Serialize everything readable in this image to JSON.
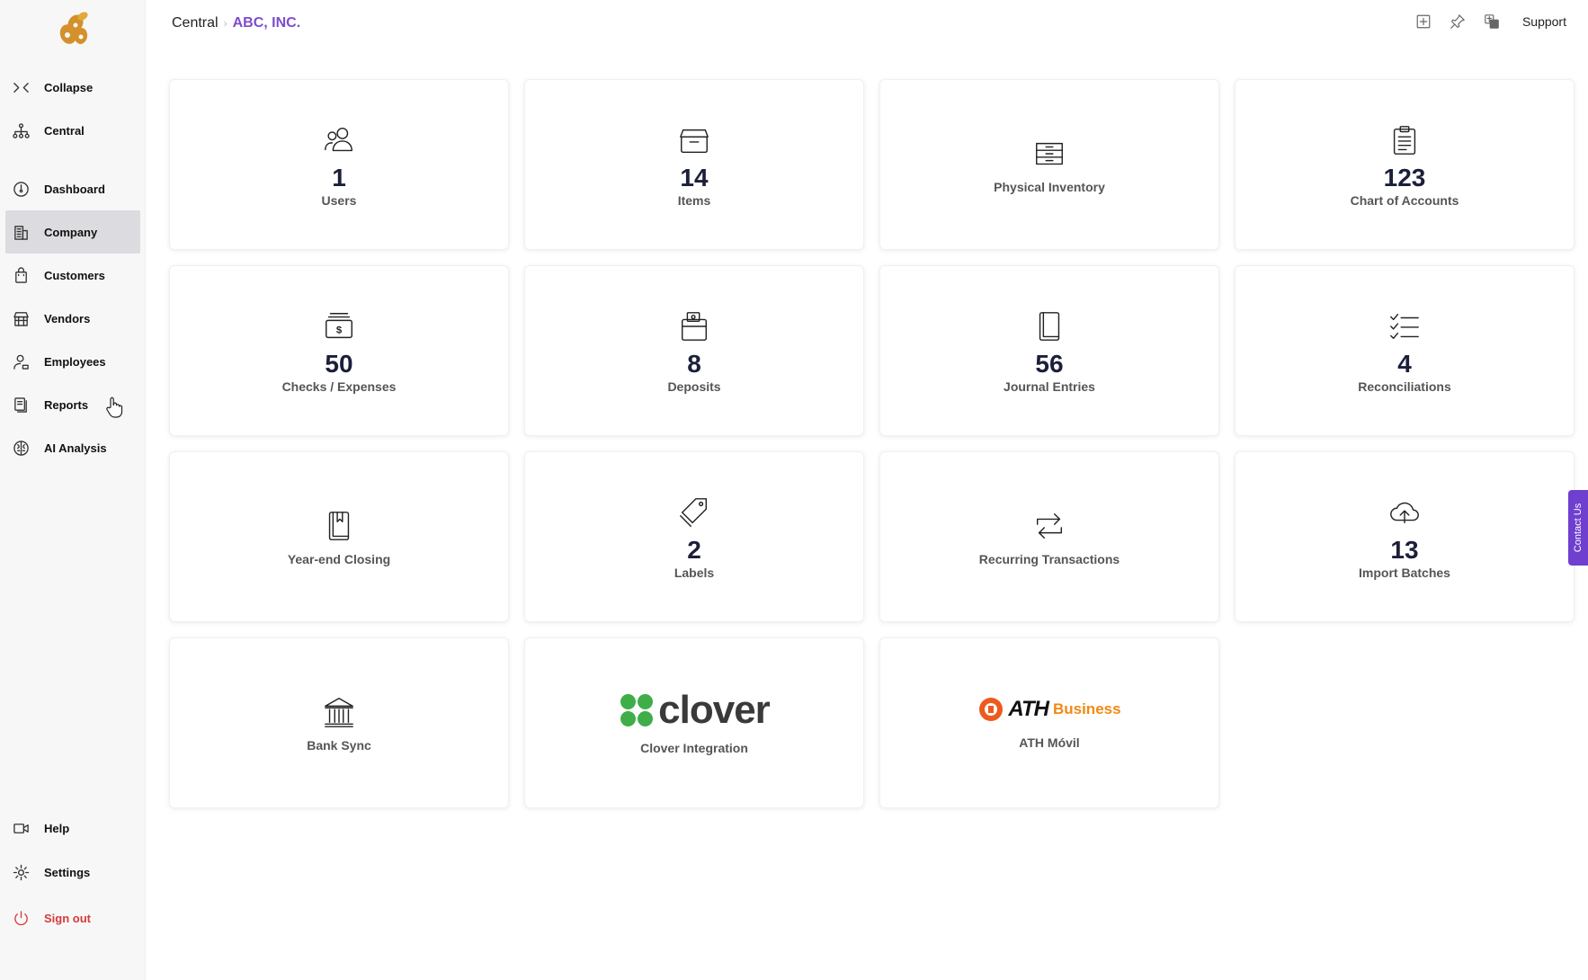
{
  "breadcrumb": {
    "root": "Central",
    "separator": "›",
    "company": "ABC, INC."
  },
  "topbar": {
    "support_label": "Support"
  },
  "sidebar": {
    "items": [
      {
        "id": "collapse",
        "label": "Collapse",
        "icon": "collapse-icon"
      },
      {
        "id": "central",
        "label": "Central",
        "icon": "sitemap-icon"
      },
      {
        "id": "dashboard",
        "label": "Dashboard",
        "icon": "gauge-icon"
      },
      {
        "id": "company",
        "label": "Company",
        "icon": "building-icon",
        "active": true
      },
      {
        "id": "customers",
        "label": "Customers",
        "icon": "shopping-bag-icon"
      },
      {
        "id": "vendors",
        "label": "Vendors",
        "icon": "store-icon"
      },
      {
        "id": "employees",
        "label": "Employees",
        "icon": "employee-icon"
      },
      {
        "id": "reports",
        "label": "Reports",
        "icon": "report-icon"
      },
      {
        "id": "ai-analysis",
        "label": "AI Analysis",
        "icon": "brain-icon"
      },
      {
        "id": "help",
        "label": "Help",
        "icon": "video-icon"
      },
      {
        "id": "settings",
        "label": "Settings",
        "icon": "gear-icon"
      },
      {
        "id": "signout",
        "label": "Sign out",
        "icon": "power-icon"
      }
    ]
  },
  "cards": [
    {
      "id": "users",
      "count": "1",
      "label": "Users",
      "icon": "users-icon"
    },
    {
      "id": "items",
      "count": "14",
      "label": "Items",
      "icon": "archive-box-icon"
    },
    {
      "id": "physical-inventory",
      "label": "Physical Inventory",
      "icon": "drawers-icon"
    },
    {
      "id": "chart-of-accounts",
      "count": "123",
      "label": "Chart of Accounts",
      "icon": "clipboard-icon"
    },
    {
      "id": "checks-expenses",
      "count": "50",
      "label": "Checks / Expenses",
      "icon": "cash-icon"
    },
    {
      "id": "deposits",
      "count": "8",
      "label": "Deposits",
      "icon": "wallet-icon"
    },
    {
      "id": "journal-entries",
      "count": "56",
      "label": "Journal Entries",
      "icon": "journal-icon"
    },
    {
      "id": "reconciliations",
      "count": "4",
      "label": "Reconciliations",
      "icon": "checklist-icon"
    },
    {
      "id": "year-end-closing",
      "label": "Year-end Closing",
      "icon": "bookmark-book-icon"
    },
    {
      "id": "labels",
      "count": "2",
      "label": "Labels",
      "icon": "tags-icon"
    },
    {
      "id": "recurring-transactions",
      "label": "Recurring Transactions",
      "icon": "repeat-icon"
    },
    {
      "id": "import-batches",
      "count": "13",
      "label": "Import Batches",
      "icon": "cloud-upload-icon"
    },
    {
      "id": "bank-sync",
      "label": "Bank Sync",
      "icon": "bank-icon"
    },
    {
      "id": "clover-integration",
      "label": "Clover Integration",
      "logo_text": "clover",
      "icon": "clover-logo-icon"
    },
    {
      "id": "ath-movil",
      "label": "ATH Móvil",
      "logo_text": "ATH",
      "logo_sub": "Business",
      "icon": "ath-logo-icon"
    }
  ],
  "contact_tab": {
    "label": "Contact Us"
  },
  "colors": {
    "accent": "#7c4dce",
    "contact": "#6f3fd0",
    "signout": "#d63a3a",
    "ath_orange": "#f08a12",
    "clover_green": "#3fae49"
  }
}
